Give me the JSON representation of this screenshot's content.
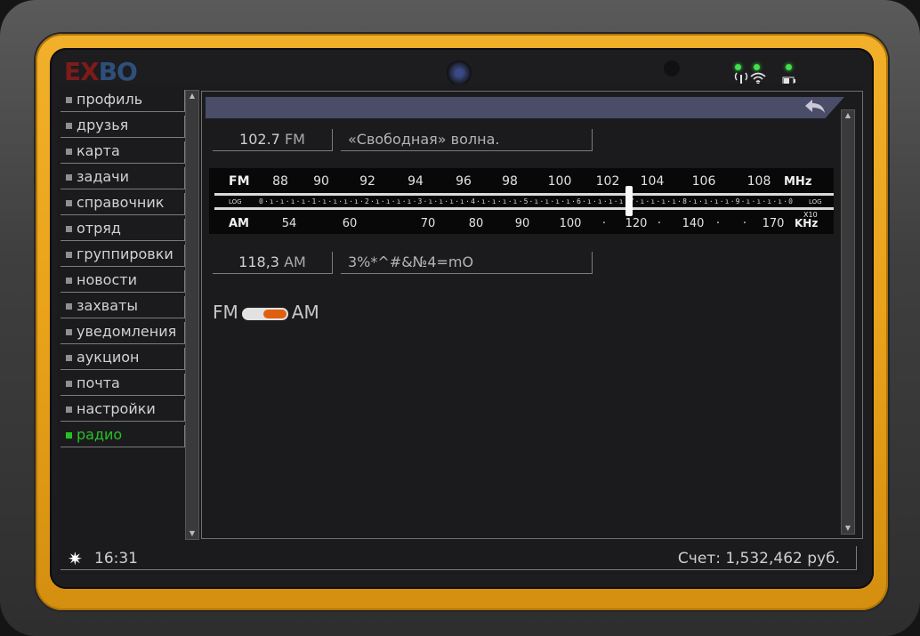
{
  "device": {
    "logo_left": "EX",
    "logo_right": "BO",
    "colors": {
      "frame": "#f0a823",
      "screen": "#1b1b1d",
      "active_menu": "#25c225",
      "toggle_knob": "#e06010"
    }
  },
  "menu": {
    "items": [
      {
        "label": "профиль"
      },
      {
        "label": "друзья"
      },
      {
        "label": "карта"
      },
      {
        "label": "задачи"
      },
      {
        "label": "справочник"
      },
      {
        "label": "отряд"
      },
      {
        "label": "группировки"
      },
      {
        "label": "новости"
      },
      {
        "label": "захваты"
      },
      {
        "label": "уведомления"
      },
      {
        "label": "аукцион"
      },
      {
        "label": "почта"
      },
      {
        "label": "настройки"
      },
      {
        "label": "радио",
        "active": true
      }
    ]
  },
  "radio": {
    "fm_station": {
      "frequency": "102.7",
      "unit": "FM",
      "name": "«Свободная» волна."
    },
    "am_station": {
      "frequency": "118,3",
      "unit": "AM",
      "name": "3%*^#&№4=mO"
    },
    "dial": {
      "fm_label": "FM",
      "fm_unit": "MHz",
      "fm_scale": [
        "88",
        "90",
        "92",
        "94",
        "96",
        "98",
        "100",
        "102",
        "104",
        "106",
        "108"
      ],
      "am_label": "AM",
      "am_unit": "KHz",
      "am_multiplier": "X10",
      "am_scale": [
        "54",
        "60",
        "70",
        "80",
        "90",
        "100",
        "·",
        "120",
        "·",
        "140",
        "·",
        "·",
        "170"
      ],
      "log_left": "LOG",
      "log_right": "LOG",
      "log_scale": "0·ı·ı·ı·ı·1·ı·ı·ı·ı·2·ı·ı·ı·ı·3·ı·ı·ı·ı·4·ı·ı·ı·ı·5·ı·ı·ı·ı·6·ı·ı·ı·ı·7·ı·ı·ı·ı·8·ı·ı·ı·ı·9·ı·ı·ı·ı·0"
    },
    "band_toggle": {
      "left_label": "FM",
      "right_label": "AM"
    }
  },
  "status": {
    "time": "16:31",
    "balance": "Счет: 1,532,462 руб."
  }
}
